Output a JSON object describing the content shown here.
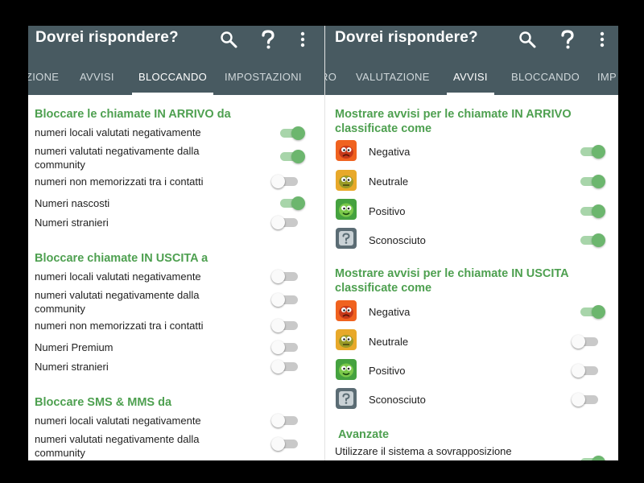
{
  "left_panel": {
    "app_title": "Dovrei rispondere?",
    "tabs": [
      "ZIONE",
      "AVVISI",
      "BLOCCANDO",
      "IMPOSTAZIONI"
    ],
    "active_tab": "BLOCCANDO",
    "sections": [
      {
        "title": "Bloccare le chiamate IN ARRIVO da",
        "items": [
          {
            "label": "numeri locali valutati negativamente",
            "enabled": true
          },
          {
            "label": "numeri valutati negativamente dalla community",
            "enabled": true
          },
          {
            "label": "numeri non memorizzati tra i contatti",
            "enabled": false
          },
          {
            "label": "Numeri nascosti",
            "enabled": true
          },
          {
            "label": "Numeri stranieri",
            "enabled": false
          }
        ]
      },
      {
        "title": "Bloccare chiamate IN USCITA a",
        "items": [
          {
            "label": "numeri locali valutati negativamente",
            "enabled": false
          },
          {
            "label": "numeri valutati negativamente dalla community",
            "enabled": false
          },
          {
            "label": "numeri non memorizzati tra i contatti",
            "enabled": false
          },
          {
            "label": "Numeri Premium",
            "enabled": false
          },
          {
            "label": "Numeri stranieri",
            "enabled": false
          }
        ]
      },
      {
        "title": "Bloccare SMS & MMS da",
        "items": [
          {
            "label": "numeri locali valutati negativamente",
            "enabled": false
          },
          {
            "label": "numeri valutati negativamente dalla community",
            "enabled": false
          }
        ]
      }
    ]
  },
  "right_panel": {
    "app_title": "Dovrei rispondere?",
    "tabs": [
      "RO",
      "VALUTAZIONE",
      "AVVISI",
      "BLOCCANDO",
      "IMP"
    ],
    "active_tab": "AVVISI",
    "sections": [
      {
        "title": "Mostrare avvisi per le chiamate IN ARRIVO classificate come",
        "items": [
          {
            "label": "Negativa",
            "icon": "negative-rating-icon",
            "enabled": true
          },
          {
            "label": "Neutrale",
            "icon": "neutral-rating-icon",
            "enabled": true
          },
          {
            "label": "Positivo",
            "icon": "positive-rating-icon",
            "enabled": true
          },
          {
            "label": "Sconosciuto",
            "icon": "unknown-rating-icon",
            "enabled": true
          }
        ]
      },
      {
        "title": "Mostrare avvisi per le chiamate IN USCITA classificate come",
        "items": [
          {
            "label": "Negativa",
            "icon": "negative-rating-icon",
            "enabled": true
          },
          {
            "label": "Neutrale",
            "icon": "neutral-rating-icon",
            "enabled": false
          },
          {
            "label": "Positivo",
            "icon": "positive-rating-icon",
            "enabled": false
          },
          {
            "label": "Sconosciuto",
            "icon": "unknown-rating-icon",
            "enabled": false
          }
        ]
      }
    ],
    "advanced": {
      "title": "Avanzate",
      "item": {
        "label": "Utilizzare il sistema a sovrapposizione",
        "enabled": true
      }
    }
  },
  "actions": [
    "search-icon",
    "help-icon",
    "overflow-menu-icon"
  ],
  "colors": {
    "app_bar": "#485a61",
    "section_title": "#4ea050",
    "switch_on_thumb": "#6cb66e",
    "switch_on_track": "#a8d5aa",
    "switch_off_track": "#c9c9c9",
    "negative": "#f0621f",
    "neutral": "#e8a92a",
    "positive": "#45a23f",
    "unknown": "#5b6c74"
  }
}
